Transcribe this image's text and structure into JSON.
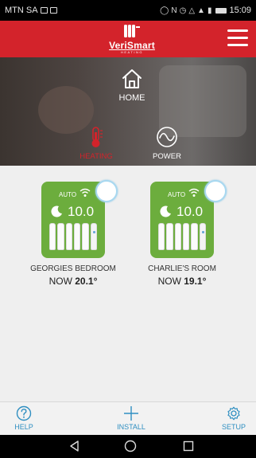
{
  "status_bar": {
    "carrier": "MTN SA",
    "time": "15:09"
  },
  "header": {
    "logo_text": "VeriSmart",
    "logo_subtext": "HEATING",
    "menu_icon": "hamburger-menu-icon",
    "color": "#d3232b"
  },
  "hero": {
    "home_label": "HOME",
    "tabs": [
      {
        "label": "HEATING",
        "icon": "thermometer-icon",
        "active": true
      },
      {
        "label": "POWER",
        "icon": "power-wave-icon",
        "active": false
      }
    ]
  },
  "devices": [
    {
      "mode": "AUTO",
      "set_temp": "10.0",
      "room": "GEORGIES BEDROOM",
      "now_prefix": "NOW",
      "now_temp": "20.1°"
    },
    {
      "mode": "AUTO",
      "set_temp": "10.0",
      "room": "CHARLIE'S ROOM",
      "now_prefix": "NOW",
      "now_temp": "19.1°"
    }
  ],
  "toolbar": {
    "help": "HELP",
    "install": "INSTALL",
    "setup": "SETUP",
    "accent": "#2f8fc1"
  },
  "colors": {
    "tile_green": "#6cad3d",
    "heating_red": "#d3232b"
  }
}
